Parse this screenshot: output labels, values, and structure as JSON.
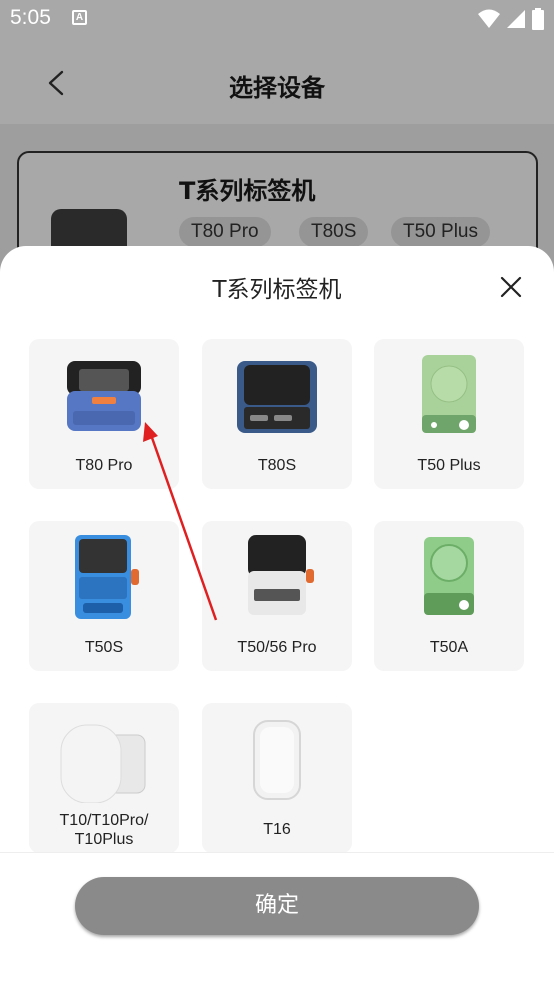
{
  "status_bar": {
    "time": "5:05",
    "notification_letter": "A"
  },
  "header": {
    "title": "选择设备"
  },
  "background_card": {
    "title": "T系列标签机",
    "chips": [
      "T80 Pro",
      "T80S",
      "T50 Plus"
    ]
  },
  "sheet": {
    "title": "T系列标签机",
    "items": [
      {
        "label": "T80 Pro",
        "icon": "printer-blue-icon"
      },
      {
        "label": "T80S",
        "icon": "printer-navy-icon"
      },
      {
        "label": "T50 Plus",
        "icon": "printer-green-icon"
      },
      {
        "label": "T50S",
        "icon": "printer-lightblue-icon"
      },
      {
        "label": "T50/56 Pro",
        "icon": "printer-white-icon"
      },
      {
        "label": "T50A",
        "icon": "printer-green-round-icon"
      },
      {
        "label": "T10/T10Pro/\nT10Plus",
        "icon": "printer-pebble-icon"
      },
      {
        "label": "T16",
        "icon": "printer-rounded-white-icon"
      }
    ],
    "confirm_label": "确定"
  },
  "colors": {
    "overlay": "#a8a8a8",
    "sheet": "#ffffff",
    "tile": "#f5f5f5",
    "confirm": "#8a8a8a",
    "arrow": "#e02020"
  }
}
